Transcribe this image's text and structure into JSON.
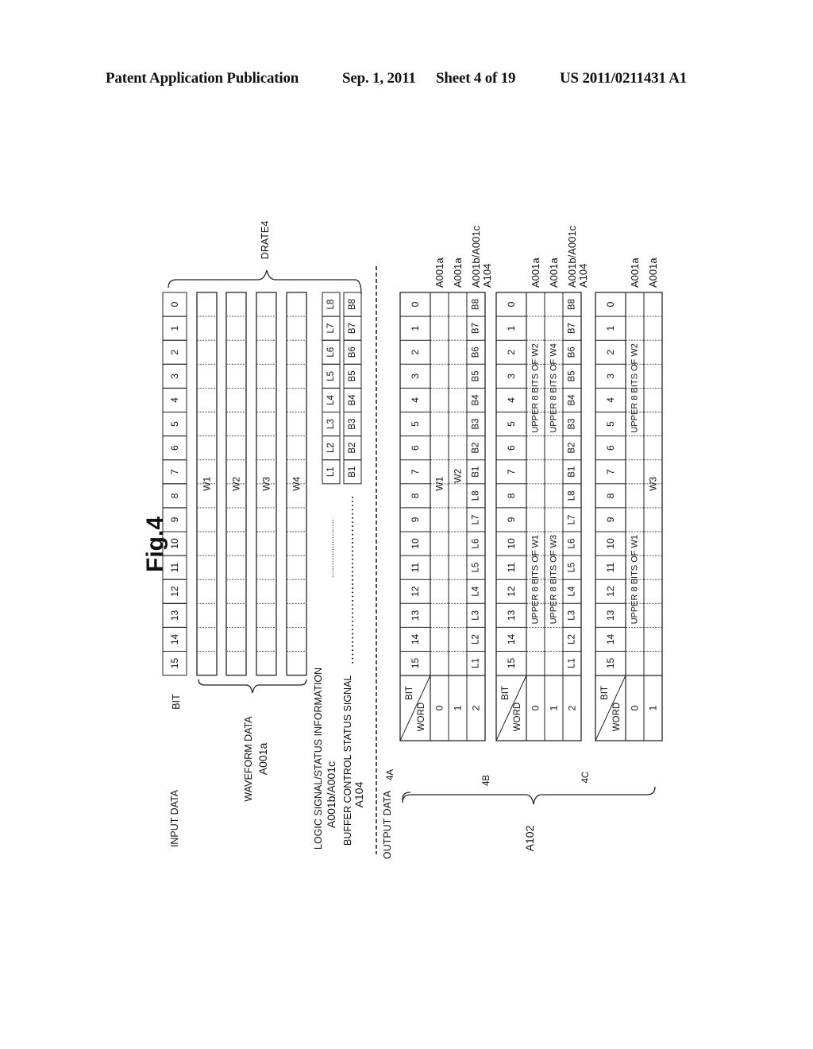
{
  "header": {
    "publication": "Patent Application Publication",
    "date": "Sep. 1, 2011",
    "sheet": "Sheet 4 of 19",
    "number": "US 2011/0211431 A1"
  },
  "figure": {
    "title": "Fig.4",
    "input": {
      "section_label": "INPUT DATA",
      "bit_label": "BIT",
      "bits": [
        "15",
        "14",
        "13",
        "12",
        "11",
        "10",
        "9",
        "8",
        "7",
        "6",
        "5",
        "4",
        "3",
        "2",
        "1",
        "0"
      ],
      "waveform_words": [
        "W1",
        "W2",
        "W3",
        "W4"
      ],
      "waveform_label": "WAVEFORM DATA",
      "waveform_ref": "A001a",
      "logic_label": "LOGIC SIGNAL/STATUS INFORMATION",
      "logic_ref": "A001b/A001c",
      "logic_bits": [
        "L1",
        "L2",
        "L3",
        "L4",
        "L5",
        "L6",
        "L7",
        "L8"
      ],
      "buffer_label": "BUFFER CONTROL STATUS SIGNAL",
      "buffer_ref": "A104",
      "buffer_bits": [
        "B1",
        "B2",
        "B3",
        "B4",
        "B5",
        "B6",
        "B7",
        "B8"
      ],
      "ellipsis": "........................",
      "brace_label": "DRATE4"
    },
    "output": {
      "section_label": "OUTPUT DATA",
      "group_ref": "A102",
      "header_bit": "BIT",
      "header_word": "WORD",
      "tables": [
        {
          "id": "4A",
          "rows": [
            {
              "word": "0",
              "type": "word16",
              "content": "W1",
              "ref": "A001a"
            },
            {
              "word": "1",
              "type": "word16",
              "content": "W2",
              "ref": "A001a"
            },
            {
              "word": "2",
              "type": "lb",
              "ref": "A001b/A001c",
              "ref2": "A104"
            }
          ]
        },
        {
          "id": "4B",
          "rows": [
            {
              "word": "0",
              "type": "split",
              "upper": "UPPER 8 BITS OF W1",
              "lower": "UPPER 8 BITS OF W2",
              "ref": "A001a"
            },
            {
              "word": "1",
              "type": "split",
              "upper": "UPPER 8 BITS OF W3",
              "lower": "UPPER 8 BITS OF W4",
              "ref": "A001a"
            },
            {
              "word": "2",
              "type": "lb",
              "ref": "A001b/A001c",
              "ref2": "A104"
            }
          ]
        },
        {
          "id": "4C",
          "rows": [
            {
              "word": "0",
              "type": "split",
              "upper": "UPPER 8 BITS OF W1",
              "lower": "UPPER 8 BITS OF W2",
              "ref": "A001a"
            },
            {
              "word": "1",
              "type": "word16",
              "content": "W3",
              "ref": "A001a"
            }
          ]
        }
      ]
    }
  }
}
